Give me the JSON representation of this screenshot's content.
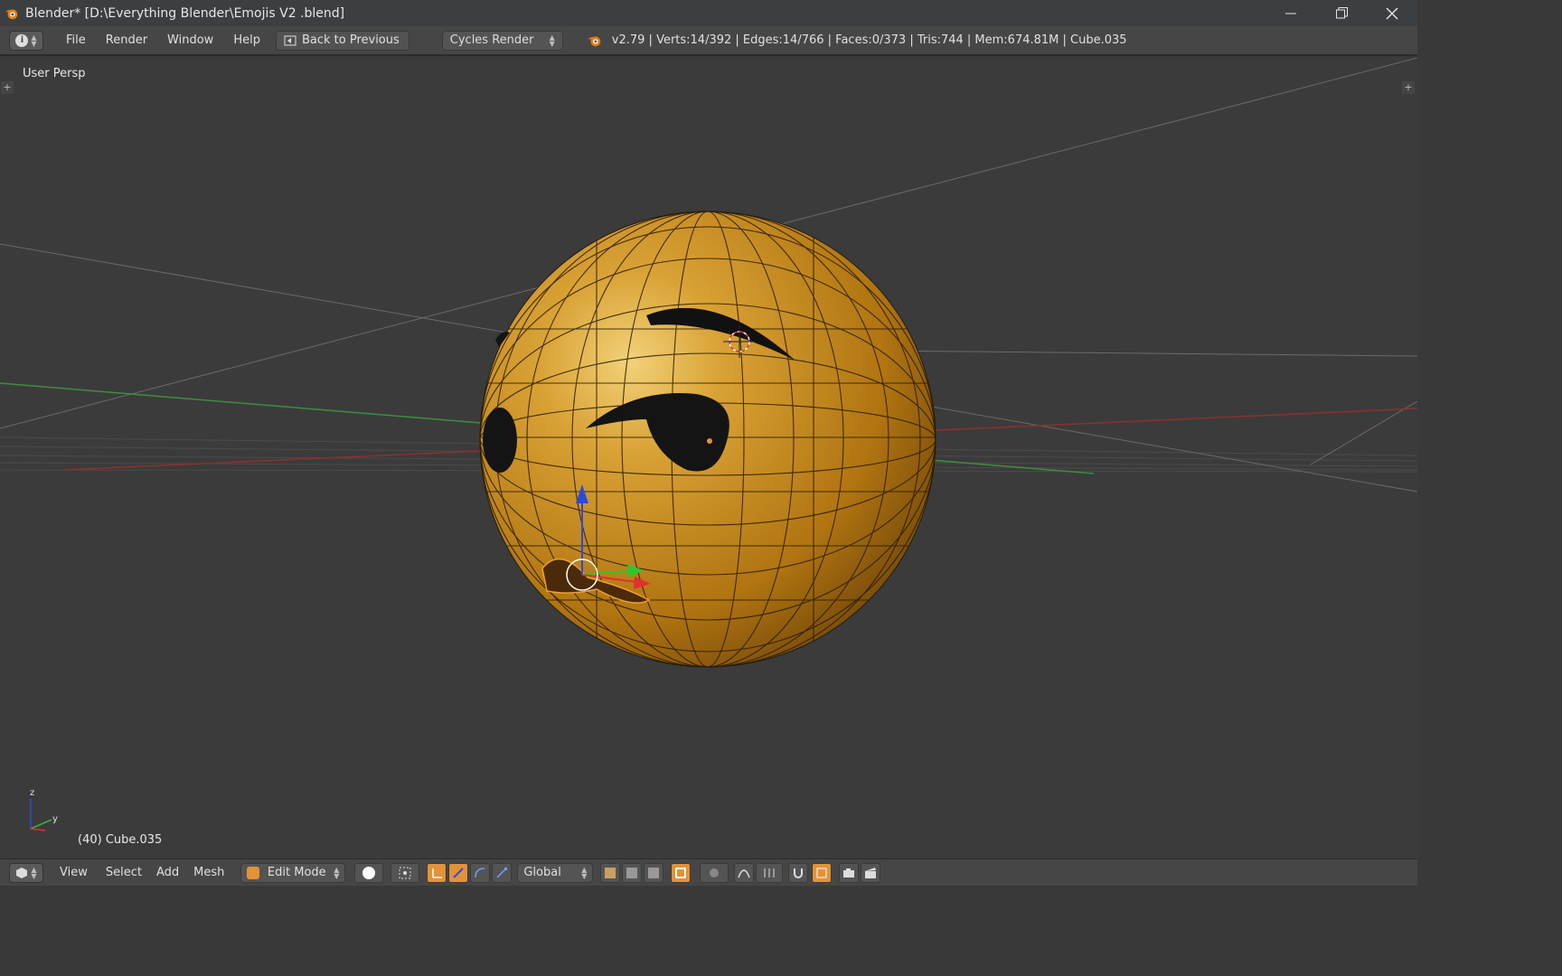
{
  "window": {
    "title": "Blender* [D:\\Everything Blender\\Emojis V2 .blend]",
    "minimize_icon": "minimize-icon",
    "restore_icon": "restore-icon",
    "close_icon": "close-icon"
  },
  "menubar": {
    "file": "File",
    "render": "Render",
    "window": "Window",
    "help": "Help",
    "back_to_previous": "Back to Previous",
    "render_engine": "Cycles Render",
    "stats": "v2.79 | Verts:14/392 | Edges:14/766 | Faces:0/373 | Tris:744 | Mem:674.81M | Cube.035"
  },
  "viewport": {
    "view_label": "User Persp",
    "object_label": "(40) Cube.035",
    "axis_z": "z",
    "axis_y": "y"
  },
  "bottom_header": {
    "view": "View",
    "select": "Select",
    "add": "Add",
    "mesh": "Mesh",
    "mode": "Edit Mode",
    "orientation": "Global"
  },
  "colors": {
    "accent_orange": "#e39237",
    "sphere": "#c98a1c",
    "background": "#3a3a3a"
  }
}
